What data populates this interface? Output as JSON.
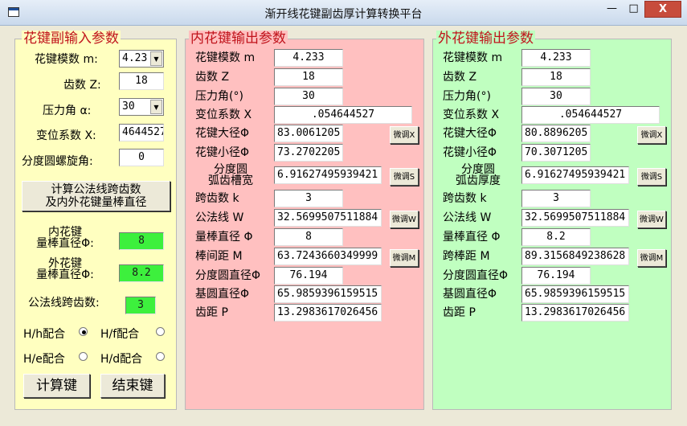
{
  "window": {
    "title": "渐开线花键副齿厚计算转换平台",
    "minimize_label": "—",
    "maximize_label": "□",
    "close_label": "X"
  },
  "input_panel": {
    "title": "花键副输入参数",
    "module_label": "花键模数 m:",
    "module_value": "4.23",
    "teeth_label": "齿数 Z:",
    "teeth_value": "18",
    "pressure_label": "压力角 α:",
    "pressure_value": "30",
    "shift_label": "变位系数 X:",
    "shift_value": "4644527",
    "helix_label": "分度圆螺旋角:",
    "helix_value": "0",
    "calc_span_button": "计算公法线跨齿数\n及内外花键量棒直径",
    "inner_rod_label": "内花键\n量棒直径Φ:",
    "inner_rod_value": "8",
    "outer_rod_label": "外花键\n量棒直径Φ:",
    "outer_rod_value": "8.2",
    "span_count_label": "公法线跨齿数:",
    "span_count_value": "3",
    "fit_hh": "H/h配合",
    "fit_hf": "H/f配合",
    "fit_he": "H/e配合",
    "fit_hd": "H/d配合",
    "calc_button": "计算键",
    "exit_button": "结束键"
  },
  "inner_panel": {
    "title": "内花键输出参数",
    "rows": [
      {
        "label": "花键模数 m",
        "value": "4.233"
      },
      {
        "label": "齿数  Z",
        "value": "18"
      },
      {
        "label": "压力角(°)",
        "value": "30"
      },
      {
        "label": "变位系数 X",
        "value": ".054644527"
      },
      {
        "label": "花键大径Φ",
        "value": "83.0061205",
        "button": "微调X"
      },
      {
        "label": "花键小径Φ",
        "value": "73.2702205"
      },
      {
        "label": "分度圆\n弧齿槽宽",
        "value": "6.91627495939421",
        "button": "微调S"
      },
      {
        "label": "跨齿数 k",
        "value": "3"
      },
      {
        "label": "公法线 W",
        "value": "32.5699507511884",
        "button": "微调W"
      },
      {
        "label": "量棒直径 Φ",
        "value": "8"
      },
      {
        "label": "棒间距 M",
        "value": "63.7243660349999",
        "button": "微调M"
      },
      {
        "label": "分度圆直径Φ",
        "value": "76.194"
      },
      {
        "label": "基圆直径Φ",
        "value": "65.9859396159515"
      },
      {
        "label": "齿距 P",
        "value": "13.2983617026456"
      }
    ]
  },
  "outer_panel": {
    "title": "外花键输出参数",
    "rows": [
      {
        "label": "花键模数 m",
        "value": "4.233"
      },
      {
        "label": "齿数  Z",
        "value": "18"
      },
      {
        "label": "压力角(°)",
        "value": "30"
      },
      {
        "label": "变位系数 X",
        "value": ".054644527"
      },
      {
        "label": "花键大径Φ",
        "value": "80.8896205",
        "button": "微调X"
      },
      {
        "label": "花键小径Φ",
        "value": "70.3071205"
      },
      {
        "label": "分度圆\n弧齿厚度",
        "value": "6.91627495939421",
        "button": "微调S"
      },
      {
        "label": "跨齿数 k",
        "value": "3"
      },
      {
        "label": "公法线 W",
        "value": "32.5699507511884",
        "button": "微调W"
      },
      {
        "label": "量棒直径 Φ",
        "value": "8.2"
      },
      {
        "label": "跨棒距 M",
        "value": "89.3156849238628",
        "button": "微调M"
      },
      {
        "label": "分度圆直径Φ",
        "value": "76.194"
      },
      {
        "label": "基圆直径Φ",
        "value": "65.9859396159515"
      },
      {
        "label": "齿距 P",
        "value": "13.2983617026456"
      }
    ]
  }
}
